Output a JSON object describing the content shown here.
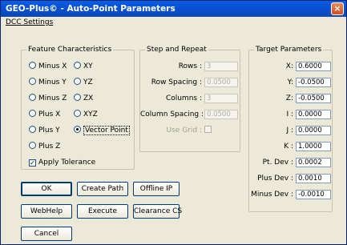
{
  "window": {
    "title": "GEO-Plus© - Auto-Point Parameters",
    "close_glyph": "×"
  },
  "menu": {
    "items": [
      {
        "label": "DCC Settings"
      }
    ]
  },
  "feature": {
    "title": "Feature Characteristics",
    "options": [
      {
        "label": "Minus X",
        "selected": false
      },
      {
        "label": "XY",
        "selected": false
      },
      {
        "label": "Minus Y",
        "selected": false
      },
      {
        "label": "YZ",
        "selected": false
      },
      {
        "label": "Minus Z",
        "selected": false
      },
      {
        "label": "ZX",
        "selected": false
      },
      {
        "label": "Plus X",
        "selected": false
      },
      {
        "label": "XYZ",
        "selected": false
      },
      {
        "label": "Plus Y",
        "selected": false
      },
      {
        "label": "Vector Point",
        "selected": true
      },
      {
        "label": "Plus Z",
        "selected": false
      }
    ],
    "apply_tolerance": {
      "label": "Apply Tolerance",
      "checked": true
    }
  },
  "step": {
    "title": "Step and Repeat",
    "rows": {
      "label": "Rows :",
      "value": "3"
    },
    "row_spacing": {
      "label": "Row Spacing :",
      "value": "0.0500"
    },
    "columns": {
      "label": "Columns :",
      "value": "3"
    },
    "column_spacing": {
      "label": "Column Spacing :",
      "value": "0.0500"
    },
    "use_grid": {
      "label": "Use Grid :",
      "checked": false
    }
  },
  "target": {
    "title": "Target Parameters",
    "fields": [
      {
        "label": "X:",
        "value": "0.6000"
      },
      {
        "label": "Y:",
        "value": "-0.0500"
      },
      {
        "label": "Z:",
        "value": "-0.0500"
      },
      {
        "label": "I :",
        "value": "0.0000"
      },
      {
        "label": "J :",
        "value": "0.0000"
      },
      {
        "label": "K :",
        "value": "1.0000"
      },
      {
        "label": "Pt. Dev :",
        "value": "0.0002"
      },
      {
        "label": "Plus Dev :",
        "value": "0.0010"
      },
      {
        "label": "Minus Dev :",
        "value": "-0.0010"
      }
    ]
  },
  "buttons": {
    "ok": "OK",
    "create_path": "Create Path",
    "offline_ip": "Offline IP",
    "webhelp": "WebHelp",
    "execute": "Execute",
    "clearance_cs": "Clearance CS",
    "cancel": "Cancel"
  }
}
